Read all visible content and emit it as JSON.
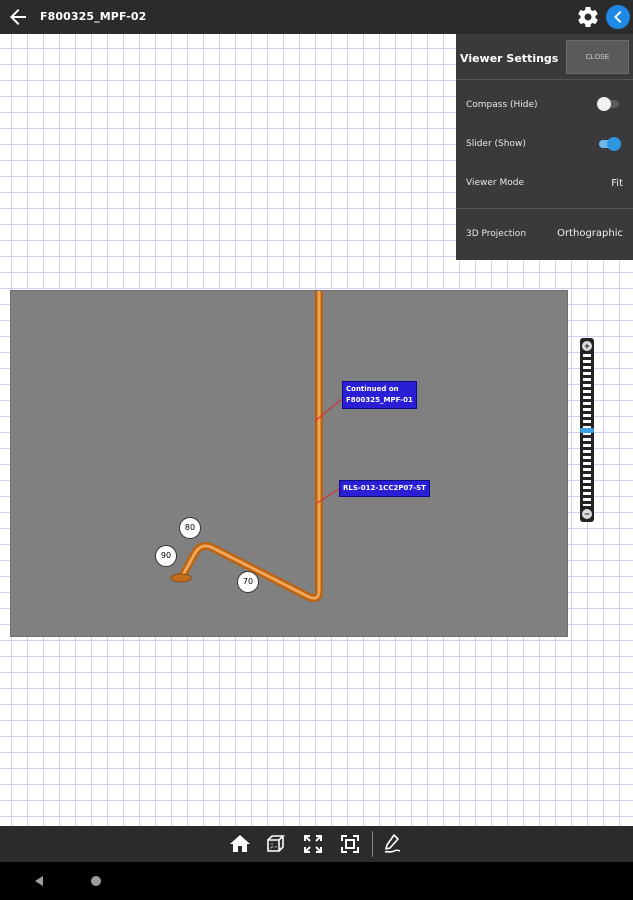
{
  "header": {
    "title": "F800325_MPF-02"
  },
  "settings_panel": {
    "title": "Viewer Settings",
    "close_label": "CLOSE",
    "rows": [
      {
        "label": "Compass (Hide)",
        "type": "toggle",
        "state": "off"
      },
      {
        "label": "Slider (Show)",
        "type": "toggle",
        "state": "on"
      },
      {
        "label": "Viewer Mode",
        "type": "value",
        "value": "Fit"
      },
      {
        "label": "3D Projection",
        "type": "value",
        "value": "Orthographic"
      }
    ]
  },
  "model": {
    "tags": [
      {
        "text": "Continued on\nF800325_MPF-01"
      },
      {
        "text": "RLS-012-1CC2P07-ST"
      }
    ],
    "welds": [
      "80",
      "90",
      "70"
    ],
    "pipe_color": "#d9781a",
    "background_color": "#808080"
  },
  "zoom_slider": {
    "plus": "+",
    "minus": "−",
    "level": 0.5
  },
  "colors": {
    "accent": "#1e88e5",
    "tag_fill": "#2b1fd6",
    "toolbar": "#2b2b2b"
  },
  "icons": {
    "back": "arrow-left-icon",
    "settings": "gear-icon",
    "collapse": "chevron-left-icon",
    "home": "home-icon",
    "cube": "cube-view-icon",
    "fit": "fit-screen-icon",
    "focus": "focus-selection-icon",
    "markup": "pen-markup-icon"
  }
}
